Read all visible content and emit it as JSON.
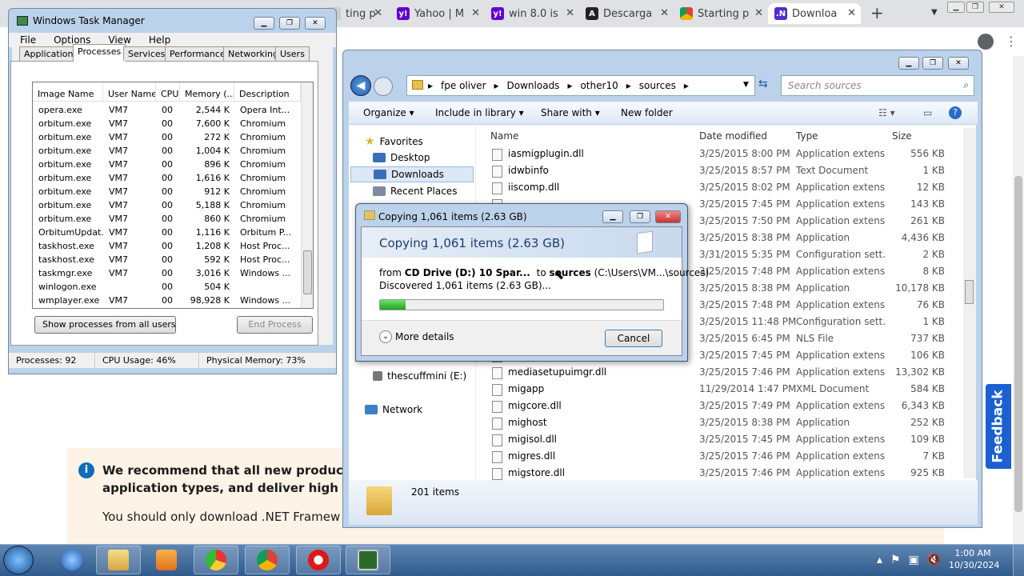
{
  "browser": {
    "tabs": [
      {
        "label": "ting p",
        "icon": "page-icon"
      },
      {
        "label": "Yahoo | M",
        "icon": "yahoo-icon"
      },
      {
        "label": "win 8.0 is",
        "icon": "yahoo-icon"
      },
      {
        "label": "Descarga",
        "icon": "archive-icon"
      },
      {
        "label": "Starting p",
        "icon": "chrome-icon"
      },
      {
        "label": "Downloa",
        "icon": "dotnet-icon"
      }
    ],
    "new_tab": "+",
    "page": {
      "banner_bold_line1": "We recommend that all new product",
      "banner_bold_line2": "application types, and deliver high pe",
      "banner_text": "You should only download .NET Framew",
      "feedback": "Feedback"
    }
  },
  "taskmgr": {
    "title": "Windows Task Manager",
    "menu": [
      "File",
      "Options",
      "View",
      "Help"
    ],
    "tabs": [
      "Applications",
      "Processes",
      "Services",
      "Performance",
      "Networking",
      "Users"
    ],
    "active_tab": "Processes",
    "columns": [
      "Image Name",
      "User Name",
      "CPU",
      "Memory (...",
      "Description"
    ],
    "rows": [
      [
        "opera.exe",
        "VM7",
        "00",
        "2,544 K",
        "Opera Int..."
      ],
      [
        "orbitum.exe",
        "VM7",
        "00",
        "7,600 K",
        "Chromium"
      ],
      [
        "orbitum.exe",
        "VM7",
        "00",
        "272 K",
        "Chromium"
      ],
      [
        "orbitum.exe",
        "VM7",
        "00",
        "1,004 K",
        "Chromium"
      ],
      [
        "orbitum.exe",
        "VM7",
        "00",
        "896 K",
        "Chromium"
      ],
      [
        "orbitum.exe",
        "VM7",
        "00",
        "1,616 K",
        "Chromium"
      ],
      [
        "orbitum.exe",
        "VM7",
        "00",
        "912 K",
        "Chromium"
      ],
      [
        "orbitum.exe",
        "VM7",
        "00",
        "5,188 K",
        "Chromium"
      ],
      [
        "orbitum.exe",
        "VM7",
        "00",
        "860 K",
        "Chromium"
      ],
      [
        "OrbitumUpdat...",
        "VM7",
        "00",
        "1,116 K",
        "Orbitum P..."
      ],
      [
        "taskhost.exe",
        "VM7",
        "00",
        "1,208 K",
        "Host Proc..."
      ],
      [
        "taskhost.exe",
        "VM7",
        "00",
        "592 K",
        "Host Proc..."
      ],
      [
        "taskmgr.exe",
        "VM7",
        "00",
        "3,016 K",
        "Windows ..."
      ],
      [
        "winlogon.exe",
        "",
        "00",
        "504 K",
        ""
      ],
      [
        "wmplayer.exe",
        "VM7",
        "00",
        "98,928 K",
        "Windows ..."
      ]
    ],
    "show_all_button": "Show processes from all users",
    "end_process_button": "End Process",
    "status": {
      "processes": "Processes: 92",
      "cpu": "CPU Usage: 46%",
      "memory": "Physical Memory: 73%"
    }
  },
  "explorer": {
    "breadcrumbs": [
      "fpe oliver",
      "Downloads",
      "other10",
      "sources"
    ],
    "search_placeholder": "Search sources",
    "commands": [
      "Organize",
      "Include in library",
      "Share with",
      "New folder"
    ],
    "nav": {
      "favorites": "Favorites",
      "desktop": "Desktop",
      "downloads": "Downloads",
      "recent": "Recent Places",
      "drive": "thescuffmini (E:)",
      "network": "Network"
    },
    "columns": [
      "Name",
      "Date modified",
      "Type",
      "Size"
    ],
    "rows": [
      [
        "iasmigplugin.dll",
        "3/25/2015 8:00 PM",
        "Application extens...",
        "556 KB"
      ],
      [
        "idwbinfo",
        "3/25/2015 8:57 PM",
        "Text Document",
        "1 KB"
      ],
      [
        "iiscomp.dll",
        "3/25/2015 8:02 PM",
        "Application extens...",
        "12 KB"
      ],
      [
        "",
        "3/25/2015 7:45 PM",
        "Application extens...",
        "143 KB"
      ],
      [
        "",
        "3/25/2015 7:50 PM",
        "Application extens...",
        "261 KB"
      ],
      [
        "",
        "3/25/2015 8:38 PM",
        "Application",
        "4,436 KB"
      ],
      [
        "",
        "3/31/2015 5:35 PM",
        "Configuration sett...",
        "2 KB"
      ],
      [
        "",
        "3/25/2015 7:48 PM",
        "Application extens...",
        "8 KB"
      ],
      [
        "",
        "3/25/2015 8:38 PM",
        "Application",
        "10,178 KB"
      ],
      [
        "",
        "3/25/2015 7:48 PM",
        "Application extens...",
        "76 KB"
      ],
      [
        "",
        "3/25/2015 11:48 PM",
        "Configuration sett...",
        "1 KB"
      ],
      [
        "",
        "3/25/2015 6:45 PM",
        "NLS File",
        "737 KB"
      ],
      [
        "",
        "3/25/2015 7:45 PM",
        "Application extens...",
        "106 KB"
      ],
      [
        "mediasetupuimgr.dll",
        "3/25/2015 7:46 PM",
        "Application extens...",
        "13,302 KB"
      ],
      [
        "migapp",
        "11/29/2014 1:47 PM",
        "XML Document",
        "584 KB"
      ],
      [
        "migcore.dll",
        "3/25/2015 7:49 PM",
        "Application extens...",
        "6,343 KB"
      ],
      [
        "mighost",
        "3/25/2015 8:38 PM",
        "Application",
        "252 KB"
      ],
      [
        "migisol.dll",
        "3/25/2015 7:45 PM",
        "Application extens...",
        "109 KB"
      ],
      [
        "migres.dll",
        "3/25/2015 7:46 PM",
        "Application extens...",
        "7 KB"
      ],
      [
        "migstore.dll",
        "3/25/2015 7:46 PM",
        "Application extens...",
        "925 KB"
      ]
    ],
    "item_count": "201 items"
  },
  "copy_dialog": {
    "title": "Copying 1,061 items (2.63 GB)",
    "heading": "Copying 1,061 items (2.63 GB)",
    "from_label": "from",
    "from_value": "CD Drive (D:) 10 Spar...",
    "to_label": "to",
    "to_value": "sources",
    "to_path": "(C:\\Users\\VM...\\sources)",
    "discovered": "Discovered 1,061 items (2.63 GB)...",
    "progress": 0.09,
    "more_details": "More details",
    "cancel": "Cancel"
  },
  "taskbar": {
    "time": "1:00 AM",
    "date": "10/30/2024"
  }
}
